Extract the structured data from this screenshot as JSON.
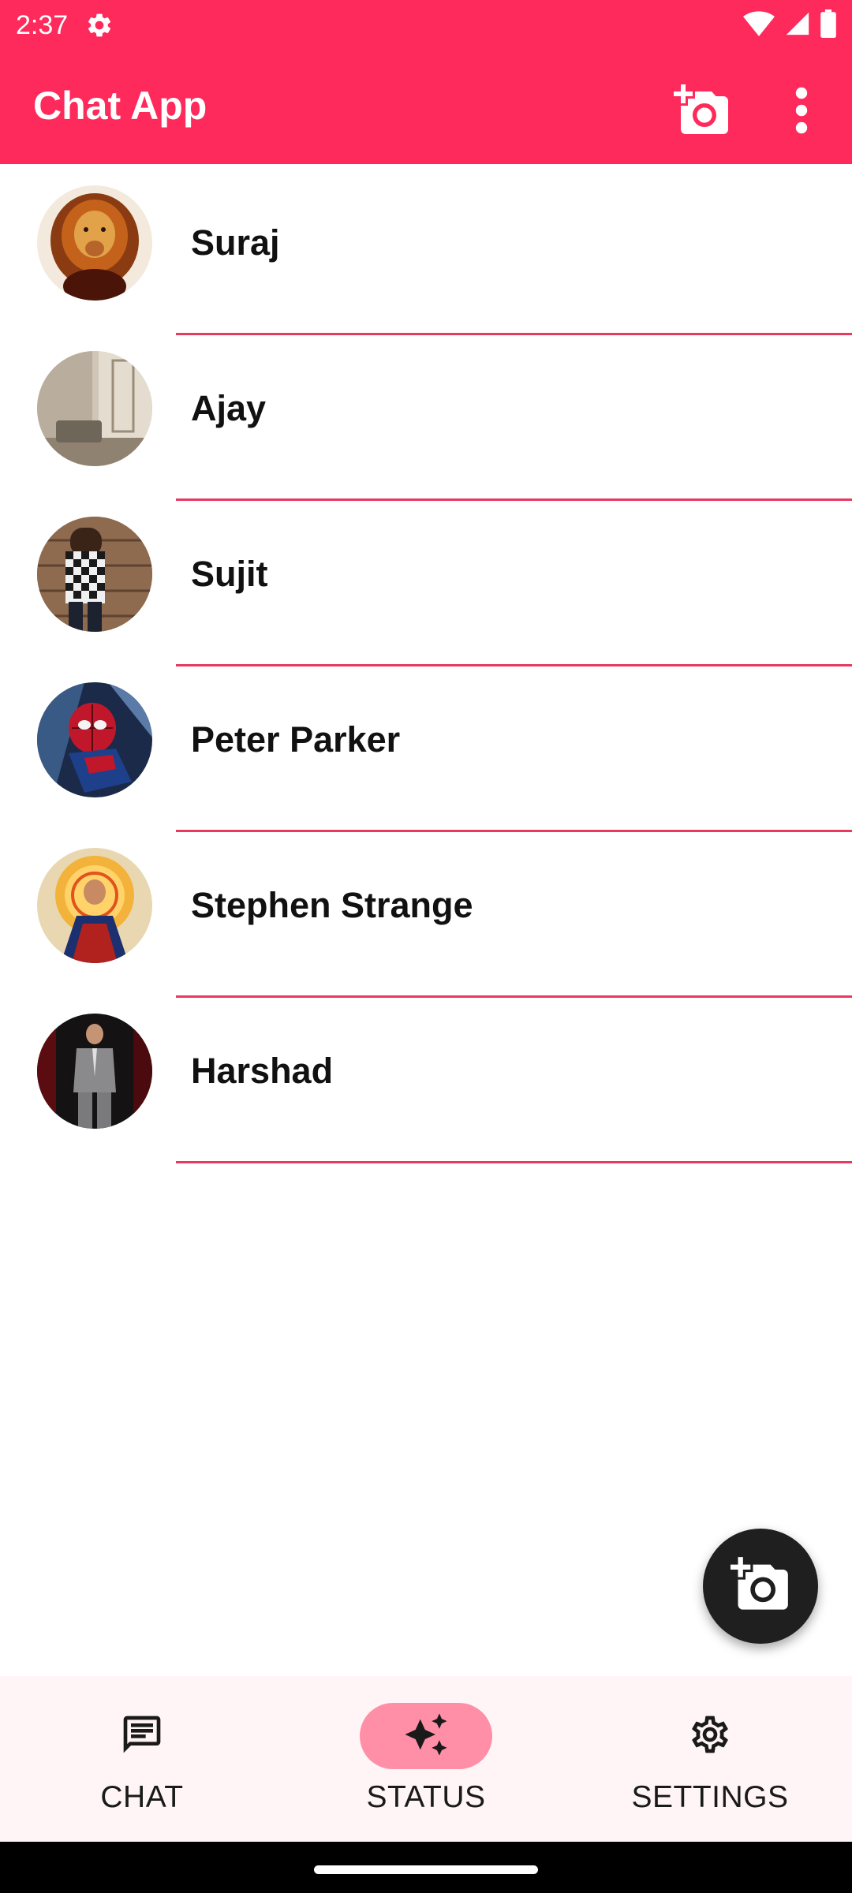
{
  "status_bar": {
    "time": "2:37",
    "icons": [
      "settings-icon",
      "wifi-icon",
      "cellular-signal-icon",
      "battery-icon"
    ]
  },
  "app_bar": {
    "title": "Chat App",
    "actions": [
      "add-photo-icon",
      "more-vert-icon"
    ]
  },
  "contacts": [
    {
      "name": "Suraj",
      "avatar": "lion"
    },
    {
      "name": "Ajay",
      "avatar": "room-interior"
    },
    {
      "name": "Sujit",
      "avatar": "man-checkered-shirt"
    },
    {
      "name": "Peter Parker",
      "avatar": "spider-man"
    },
    {
      "name": "Stephen Strange",
      "avatar": "doctor-strange"
    },
    {
      "name": "Harshad",
      "avatar": "man-grey-suit"
    }
  ],
  "fab": {
    "icon": "add-photo-icon"
  },
  "bottom_nav": {
    "items": [
      {
        "label": "CHAT",
        "icon": "chat-icon",
        "active": false
      },
      {
        "label": "STATUS",
        "icon": "auto-awesome-icon",
        "active": true
      },
      {
        "label": "SETTINGS",
        "icon": "gear-icon",
        "active": false
      }
    ]
  },
  "colors": {
    "primary": "#ff2a5c",
    "divider": "#e8395f",
    "nav_active_pill": "#ff8fa6",
    "nav_background": "#fff5f6",
    "fab": "#1f1f1f"
  }
}
